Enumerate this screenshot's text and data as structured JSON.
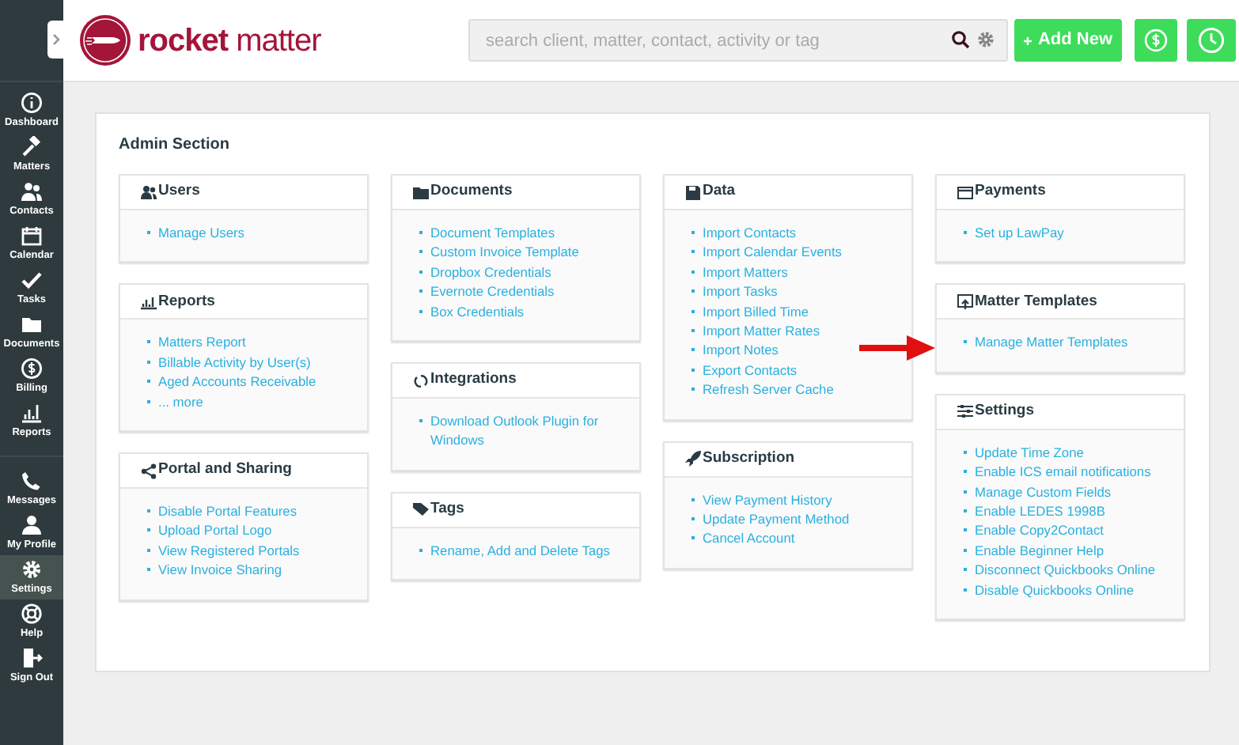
{
  "sidebar": {
    "groups": [
      [
        {
          "label": "Dashboard",
          "selected": false
        },
        {
          "label": "Matters",
          "selected": false
        },
        {
          "label": "Contacts",
          "selected": false
        },
        {
          "label": "Calendar",
          "selected": false
        },
        {
          "label": "Tasks",
          "selected": false
        },
        {
          "label": "Documents",
          "selected": false
        },
        {
          "label": "Billing",
          "selected": false
        },
        {
          "label": "Reports",
          "selected": false
        }
      ],
      [
        {
          "label": "Messages",
          "selected": false
        },
        {
          "label": "My Profile",
          "selected": false
        },
        {
          "label": "Settings",
          "selected": true
        },
        {
          "label": "Help",
          "selected": false
        },
        {
          "label": "Sign Out",
          "selected": false
        }
      ]
    ]
  },
  "header": {
    "logo": {
      "word_1": "rocket",
      "word_2": "matter"
    },
    "search": {
      "placeholder": "search client, matter, contact, activity or tag"
    },
    "add_button": "Add New"
  },
  "admin": {
    "title": "Admin Section",
    "columns": [
      [
        {
          "title": "Users",
          "links": [
            "Manage Users"
          ]
        },
        {
          "title": "Reports",
          "links": [
            "Matters Report",
            "Billable Activity by User(s)",
            "Aged Accounts Receivable",
            "... more"
          ]
        },
        {
          "title": "Portal and Sharing",
          "links": [
            "Disable Portal Features",
            "Upload Portal Logo",
            "View Registered Portals",
            "View Invoice Sharing"
          ]
        }
      ],
      [
        {
          "title": "Documents",
          "links": [
            "Document Templates",
            "Custom Invoice Template",
            "Dropbox Credentials",
            "Evernote Credentials",
            "Box Credentials"
          ]
        },
        {
          "title": "Integrations",
          "links": [
            "Download Outlook Plugin for Windows"
          ]
        },
        {
          "title": "Tags",
          "links": [
            "Rename, Add and Delete Tags"
          ]
        }
      ],
      [
        {
          "title": "Data",
          "links": [
            "Import Contacts",
            "Import Calendar Events",
            "Import Matters",
            "Import Tasks",
            "Import Billed Time",
            "Import Matter Rates",
            "Import Notes",
            "Export Contacts",
            "Refresh Server Cache"
          ]
        },
        {
          "title": "Subscription",
          "links": [
            "View Payment History",
            "Update Payment Method",
            "Cancel Account"
          ]
        }
      ],
      [
        {
          "title": "Payments",
          "links": [
            "Set up LawPay"
          ]
        },
        {
          "title": "Matter Templates",
          "links": [
            "Manage Matter Templates"
          ]
        },
        {
          "title": "Settings",
          "links": [
            "Update Time Zone",
            "Enable ICS email notifications",
            "Manage Custom Fields",
            "Enable LEDES 1998B",
            "Enable Copy2Contact",
            "Enable Beginner Help",
            "Disconnect Quickbooks Online",
            "Disable Quickbooks Online"
          ]
        }
      ]
    ]
  }
}
